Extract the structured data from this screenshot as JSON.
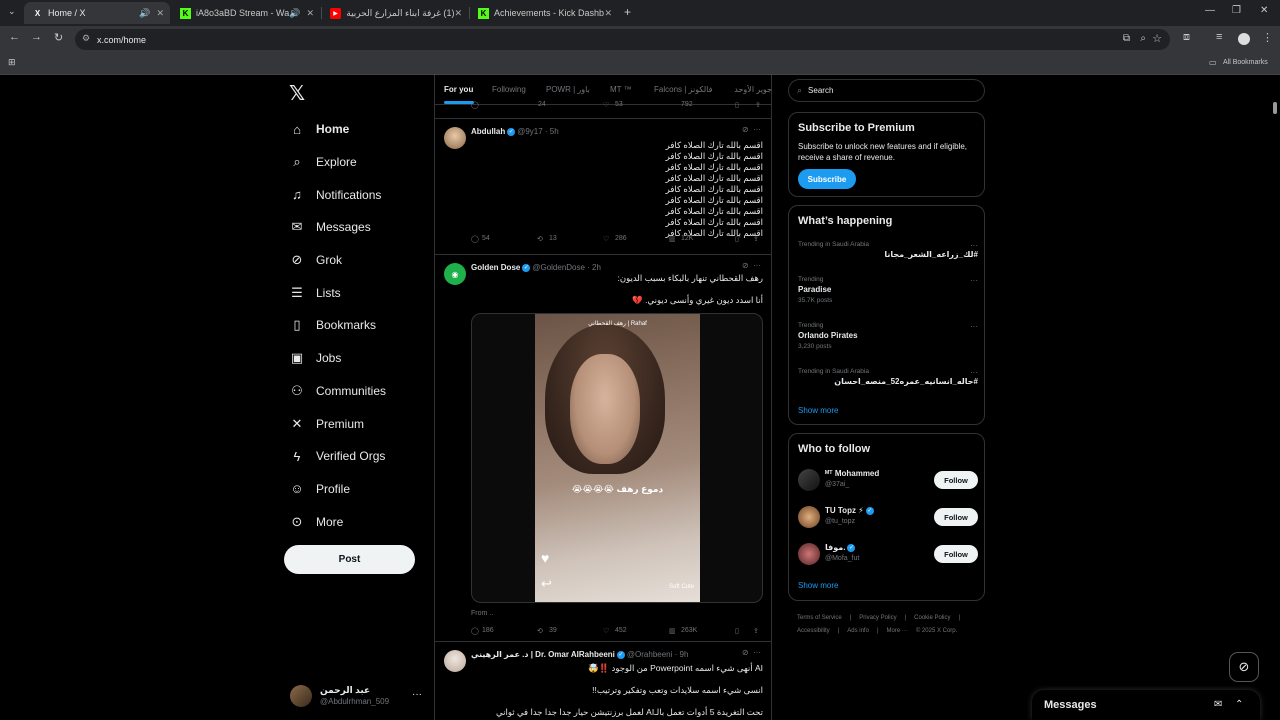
{
  "browser": {
    "tabs": [
      {
        "title": "Home / X",
        "favicon": "X",
        "active": true
      },
      {
        "title": "iA8o3aBD Stream - Watch Li",
        "favicon": "K"
      },
      {
        "title": "(1) غرفة ابناء المزارع الحربية - يو",
        "favicon": "▶"
      },
      {
        "title": "Achievements - Kick Dashboard",
        "favicon": "K"
      }
    ],
    "url": "x.com/home",
    "bookmarks_label": "All Bookmarks"
  },
  "nav": {
    "items": [
      {
        "label": "Home",
        "icon": "home-icon",
        "glyph": "⌂"
      },
      {
        "label": "Explore",
        "icon": "search-icon",
        "glyph": "⌕"
      },
      {
        "label": "Notifications",
        "icon": "bell-icon",
        "glyph": "♫"
      },
      {
        "label": "Messages",
        "icon": "envelope-icon",
        "glyph": "✉"
      },
      {
        "label": "Grok",
        "icon": "grok-icon",
        "glyph": "⊘"
      },
      {
        "label": "Lists",
        "icon": "list-icon",
        "glyph": "☰"
      },
      {
        "label": "Bookmarks",
        "icon": "bookmark-icon",
        "glyph": "▯"
      },
      {
        "label": "Jobs",
        "icon": "briefcase-icon",
        "glyph": "▣"
      },
      {
        "label": "Communities",
        "icon": "people-icon",
        "glyph": "⚇"
      },
      {
        "label": "Premium",
        "icon": "x-logo-icon",
        "glyph": "✕"
      },
      {
        "label": "Verified Orgs",
        "icon": "lightning-icon",
        "glyph": "ϟ"
      },
      {
        "label": "Profile",
        "icon": "person-icon",
        "glyph": "☺"
      },
      {
        "label": "More",
        "icon": "more-circle-icon",
        "glyph": "⊙"
      }
    ],
    "post_label": "Post"
  },
  "account": {
    "name": "عبد الرحمن",
    "handle": "@Abdulrhman_509"
  },
  "feed": {
    "tabs": [
      "For you",
      "Following",
      "POWR | باور",
      "MT ™",
      "Falcons | فالكونز",
      "جوير الأوحد"
    ],
    "remnant": {
      "replies": "24",
      "likes": "53",
      "views": "792"
    },
    "tweets": [
      {
        "name": "Abdullah",
        "handle": "@9y17",
        "time": "· 5h",
        "lines": [
          "اقسم بالله تارك الصلاه كافر",
          "اقسم بالله تارك الصلاه كافر",
          "اقسم بالله تارك الصلاه كافر",
          "اقسم بالله تارك الصلاه كافر",
          "اقسم بالله تارك الصلاه كافر",
          "اقسم بالله تارك الصلاه كافر",
          "اقسم بالله تارك الصلاه كافر",
          "اقسم بالله تارك الصلاه كافر",
          "اقسم بالله تارك الصلاه كافر"
        ],
        "replies": "54",
        "reposts": "13",
        "likes": "286",
        "views": "12K"
      },
      {
        "name": "Golden Dose",
        "handle": "@GoldenDose",
        "time": "· 2h",
        "lines": [
          "رهف القحطاني تنهار بالبكاء بسبب الديون:",
          "أنا اسدد ديون غيري وأنسى ديوني. 💔"
        ],
        "video_caption": "دموع رهف 😭😭😭😭",
        "video_top": "رهف القحطاني | Rahaf",
        "video_brand": "Soft Cute",
        "from": "From ..",
        "replies": "186",
        "reposts": "39",
        "likes": "452",
        "views": "263K"
      },
      {
        "name": "د. عمر الرهيني | Dr. Omar AlRahbeeni",
        "handle": "@Orahbeeni",
        "time": "· 9h",
        "lines": [
          "AI أنهى شيء اسمه Powerpoint من الوجود ‼️🤯",
          "انسى شيء اسمه سلايدات وتعب وتفكير وترتيب!!",
          "تحت التغريدة 5 أدوات تعمل بالـAI لعمل برزنتيشن حيار جدا جدا جدا في ثواني"
        ]
      }
    ]
  },
  "right": {
    "search_placeholder": "Search",
    "premium": {
      "title": "Subscribe to Premium",
      "desc": "Subscribe to unlock new features and if eligible, receive a share of revenue.",
      "button": "Subscribe"
    },
    "happening": {
      "title": "What’s happening",
      "trends": [
        {
          "context": "Trending in Saudi Arabia",
          "title": "#لك_زراعه_الشعر_مجانا",
          "count": "",
          "rtl": true
        },
        {
          "context": "Trending",
          "title": "Paradise",
          "count": "35.7K posts",
          "rtl": false
        },
        {
          "context": "Trending",
          "title": "Orlando Pirates",
          "count": "3,230 posts",
          "rtl": false
        },
        {
          "context": "Trending in Saudi Arabia",
          "title": "#حاله_انسانيه_عمره52_منصه_احسان",
          "count": "",
          "rtl": true
        }
      ],
      "show_more": "Show more"
    },
    "who_to_follow": {
      "title": "Who to follow",
      "accounts": [
        {
          "name": "ᴹᵀ Mohammed",
          "handle": "@37ai_",
          "verified": false
        },
        {
          "name": "TU Topz ⚡",
          "handle": "@tu_topz",
          "verified": true
        },
        {
          "name": "موفا.",
          "handle": "@Mofa_fut",
          "verified": true
        }
      ],
      "follow_label": "Follow",
      "show_more": "Show more"
    },
    "footer": [
      "Terms of Service",
      "|",
      "Privacy Policy",
      "|",
      "Cookie Policy",
      "|",
      "Accessibility",
      "|",
      "Ads info",
      "|",
      "More ···",
      "© 2025 X Corp."
    ]
  },
  "messages_drawer": {
    "title": "Messages"
  },
  "colors": {
    "accent": "#1d9bf0",
    "bg": "#000000",
    "border": "#2f3336",
    "muted": "#71767b"
  }
}
